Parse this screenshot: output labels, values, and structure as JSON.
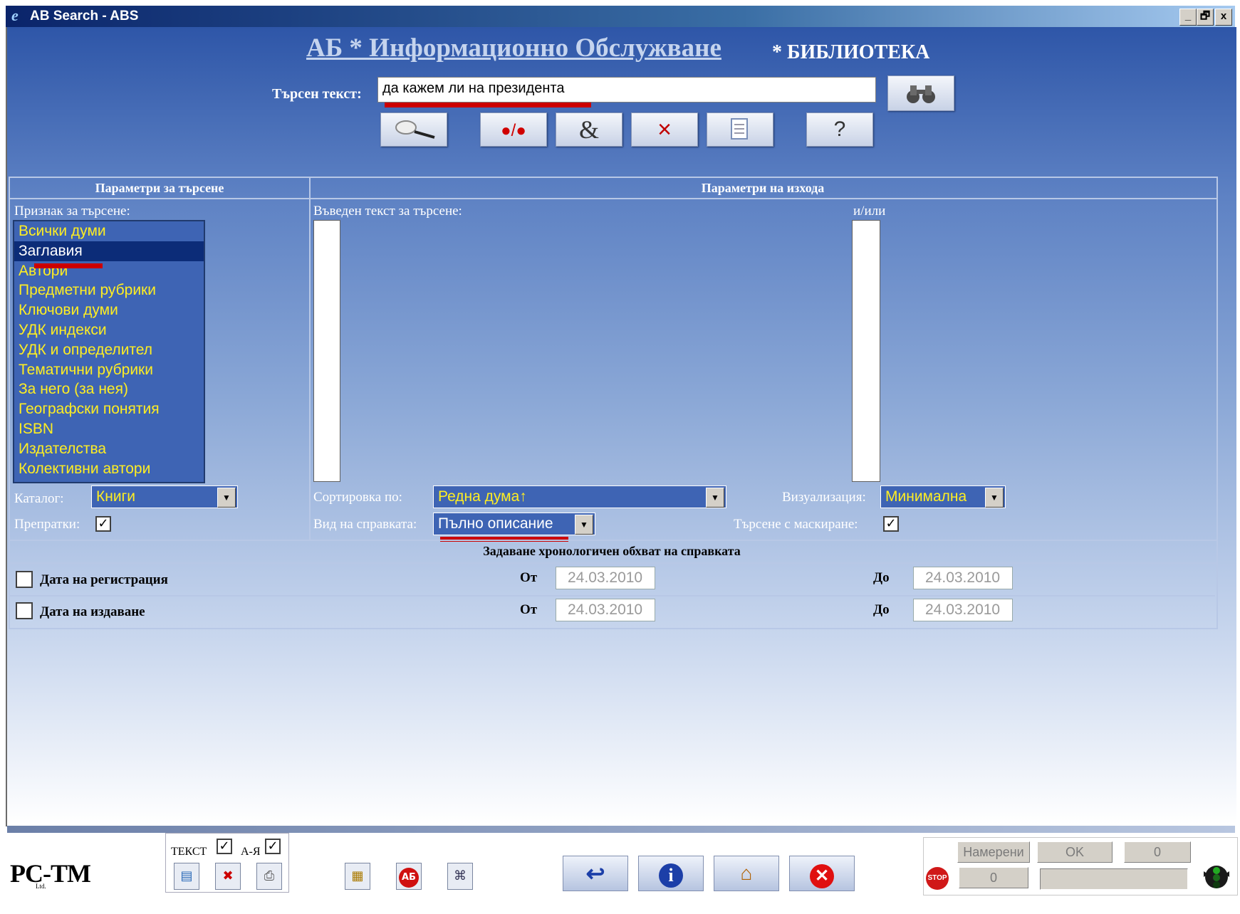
{
  "window": {
    "title": "AB Search - ABS",
    "minimize": "_",
    "restore": "🗗",
    "close": "x"
  },
  "header": {
    "title": "АБ * Информационно Обслужване",
    "subtitle": "* БИБЛИОТЕКА",
    "search_label": "Търсен текст:",
    "search_value": "да кажем ли на президента"
  },
  "toolbar": {
    "andor": "●/●",
    "ampersand": "&",
    "cross": "×",
    "help": "?"
  },
  "params": {
    "left_header": "Параметри за търсене",
    "right_header": "Параметри на изхода",
    "criterion_label": "Признак за търсене:",
    "criteria": [
      "Всички думи",
      "Заглавия",
      "Автори",
      "Предметни рубрики",
      "Ключови думи",
      "УДК индекси",
      "УДК и определител",
      "Тематични рубрики",
      "За него (за нея)",
      "Географски понятия",
      "ISBN",
      "Издателства",
      "Колективни автори"
    ],
    "entered_text_label": "Въведен текст за търсене:",
    "andor_label": "и/или",
    "catalog_label": "Каталог:",
    "catalog_value": "Книги",
    "refs_label": "Препратки:",
    "sort_label": "Сортировка по:",
    "sort_value": "Редна дума↑",
    "visual_label": "Визуализация:",
    "visual_value": "Минимална",
    "reftype_label": "Вид на справката:",
    "reftype_value": "Пълно описание",
    "mask_label": "Търсене с маскиране:"
  },
  "chrono": {
    "header": "Задаване хронологичен обхват на справката",
    "rows": [
      {
        "label": "Дата на регистрация",
        "from_label": "От",
        "from": "24.03.2010",
        "to_label": "До",
        "to": "24.03.2010"
      },
      {
        "label": "Дата на издаване",
        "from_label": "От",
        "from": "24.03.2010",
        "to_label": "До",
        "to": "24.03.2010"
      }
    ]
  },
  "footer": {
    "logo": "PC-TM",
    "logo_sub": "Ltd.",
    "text_label": "ТЕКСТ",
    "az_label": "А-Я",
    "ab_badge": "АБ",
    "found_label": "Намерени",
    "ok_label": "OK",
    "count1": "0",
    "count2": "0",
    "stop_label": "STOP"
  }
}
